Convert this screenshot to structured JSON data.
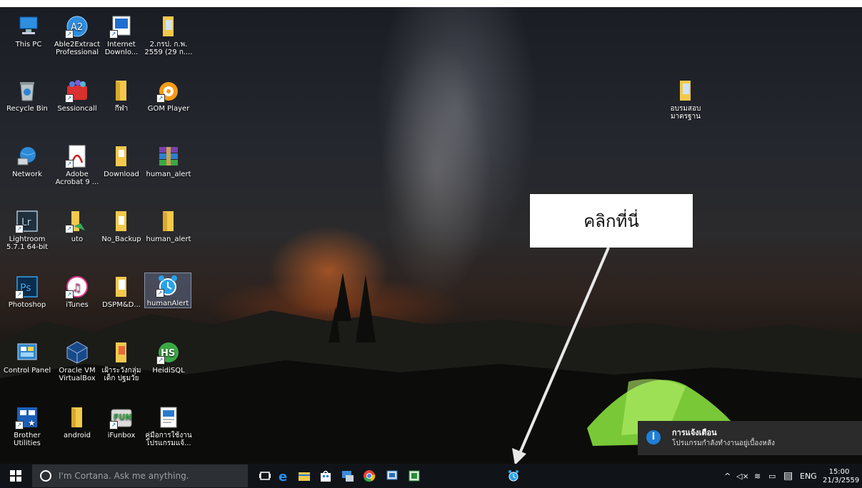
{
  "desktop": {
    "icons": [
      {
        "label": "This PC"
      },
      {
        "label": "Able2Extract Professional"
      },
      {
        "label": "Internet Downlo..."
      },
      {
        "label": "2.กรป. ก.พ. 2559 (29 ก...."
      },
      {
        "label": "Recycle Bin"
      },
      {
        "label": "Sessioncall"
      },
      {
        "label": "กีฬา"
      },
      {
        "label": "GOM Player"
      },
      {
        "label": "Network"
      },
      {
        "label": "Adobe Acrobat 9 ..."
      },
      {
        "label": "Download"
      },
      {
        "label": "human_alert"
      },
      {
        "label": "Lightroom 5.7.1 64-bit"
      },
      {
        "label": "uto"
      },
      {
        "label": "No_Backup"
      },
      {
        "label": "human_alert"
      },
      {
        "label": "Photoshop"
      },
      {
        "label": "iTunes"
      },
      {
        "label": "DSPM&D..."
      },
      {
        "label": "humanAlert"
      },
      {
        "label": "Control Panel"
      },
      {
        "label": "Oracle VM VirtualBox"
      },
      {
        "label": "เฝ้าระวังกลุ่มเด็ก ปฐมวัย"
      },
      {
        "label": "HeidiSQL"
      },
      {
        "label": "Brother Utilities"
      },
      {
        "label": "android"
      },
      {
        "label": "iFunbox"
      },
      {
        "label": "คู่มือการใช้งาน โปรแกรมแจ้..."
      },
      {
        "label": "อบรมสอบ มาตรฐาน"
      }
    ]
  },
  "callout": {
    "text": "คลิกที่นี่"
  },
  "notification": {
    "title": "การแจ้งเตือน",
    "message": "โปรแกรมกำลังทำงานอยู่เบื้องหลัง"
  },
  "taskbar": {
    "search_placeholder": "I'm Cortana. Ask me anything.",
    "language": "ENG",
    "time": "15:00",
    "date": "21/3/2559"
  },
  "colors": {
    "taskbar": "#101418",
    "notification_bg": "#2b2b2b",
    "info_accent": "#1e7fd8"
  }
}
